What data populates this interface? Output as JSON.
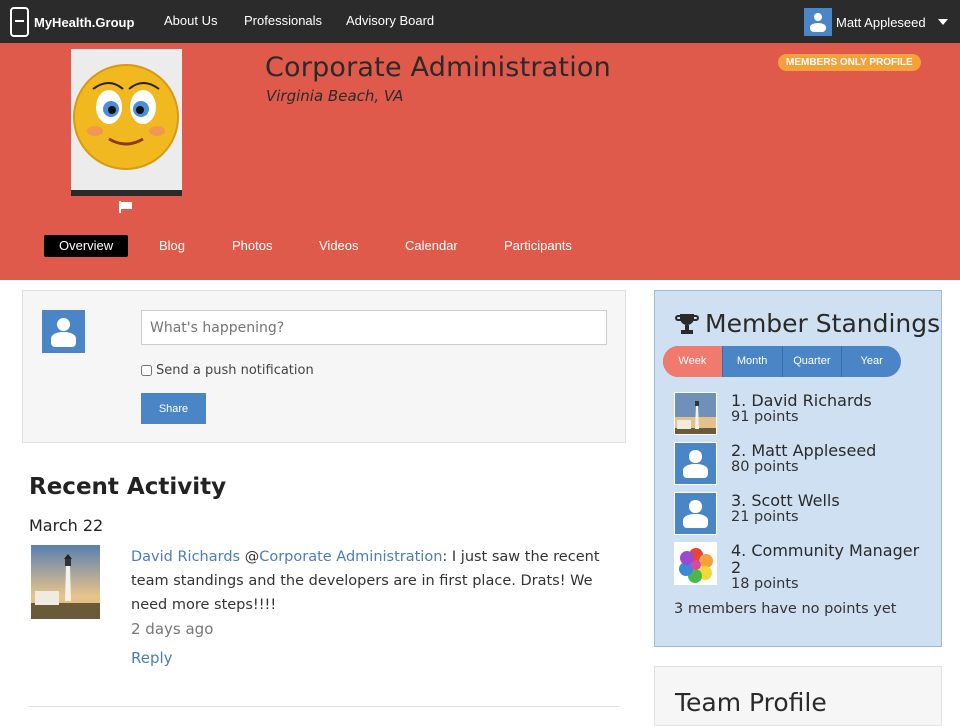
{
  "nav": {
    "brand": "MyHealth.Group",
    "links": [
      "About Us",
      "Professionals",
      "Advisory Board"
    ],
    "user_name": "Matt Appleseed"
  },
  "profile": {
    "title": "Corporate Administration",
    "location": "Virginia Beach, VA",
    "badge": "MEMBERS ONLY PROFILE",
    "tabs": [
      "Overview",
      "Blog",
      "Photos",
      "Videos",
      "Calendar",
      "Participants"
    ]
  },
  "post": {
    "placeholder": "What's happening?",
    "push_label": "Send a push notification",
    "share_label": "Share"
  },
  "activity": {
    "title": "Recent Activity",
    "date": "March 22",
    "author": "David Richards",
    "mention": "@",
    "target": "Corporate Administration",
    "message": ": I just saw the recent team standings and the developers are in first place. Drats! We need more steps!!!!",
    "ago": "2 days ago",
    "reply": "Reply"
  },
  "standings": {
    "title": "Member Standings",
    "periods": [
      "Week",
      "Month",
      "Quarter",
      "Year"
    ],
    "active_period": "Week",
    "entries": [
      {
        "name": "1. David Richards",
        "points": "91 points",
        "avatar": "lighthouse"
      },
      {
        "name": "2. Matt Appleseed",
        "points": "80 points",
        "avatar": "default-user"
      },
      {
        "name": "3. Scott Wells",
        "points": "21 points",
        "avatar": "default-user"
      },
      {
        "name": "4. Community Manager 2",
        "points": "18 points",
        "avatar": "flower"
      }
    ],
    "no_points_note": "3 members have no points yet"
  },
  "team": {
    "title": "Team Profile"
  },
  "colors": {
    "banner": "#e05a4b",
    "nav": "#2b2b2b",
    "accent": "#4a86c6",
    "badge": "#f4a13a",
    "standings_bg": "#cfe0f3"
  }
}
